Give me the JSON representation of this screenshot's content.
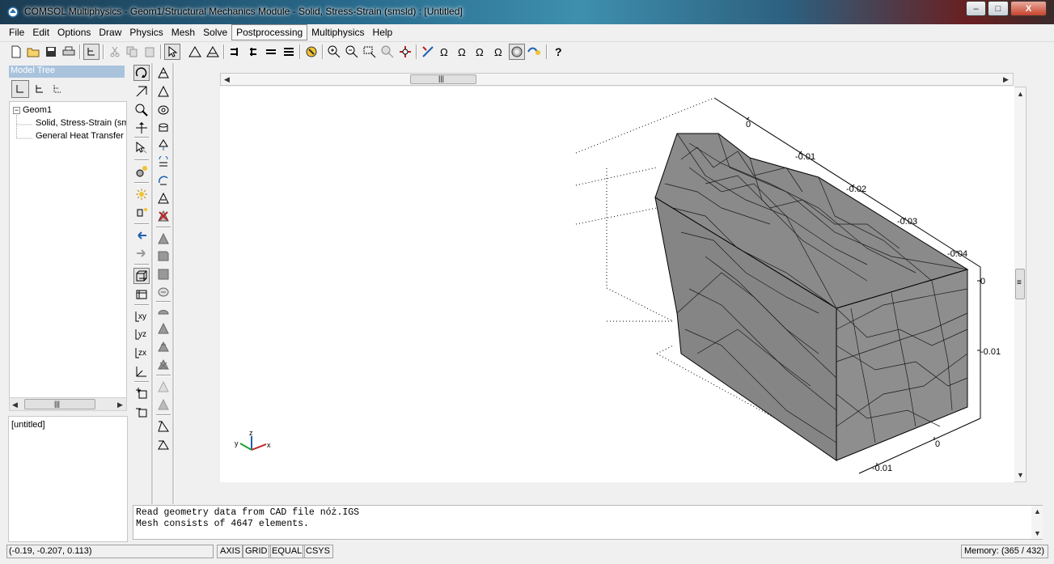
{
  "window": {
    "title": "COMSOL Multiphysics - Geom1/Structural Mechanics Module - Solid, Stress-Strain (smsld) : [Untitled]",
    "minimize_glyph": "–",
    "maximize_glyph": "□",
    "close_glyph": "X"
  },
  "menu": {
    "items": [
      "File",
      "Edit",
      "Options",
      "Draw",
      "Physics",
      "Mesh",
      "Solve",
      "Postprocessing",
      "Multiphysics",
      "Help"
    ],
    "active": "Postprocessing"
  },
  "model_tree": {
    "header": "Model Tree",
    "root": "Geom1",
    "root_expander": "−",
    "children": [
      "Solid, Stress-Strain (sm",
      "General Heat Transfer ("
    ]
  },
  "scroll": {
    "thumb_grip": "|||",
    "left_arrow": "◀",
    "right_arrow": "▶",
    "up_arrow": "▲",
    "down_arrow": "▼",
    "vertical_grip": "≡"
  },
  "file_panel": {
    "text": "[untitled]"
  },
  "console": {
    "lines": [
      "Read geometry data from CAD file nóż.IGS",
      "Mesh consists of 4647 elements."
    ]
  },
  "status": {
    "coordinates": "(-0.19, -0.207, 0.113)",
    "toggles": [
      "AXIS",
      "GRID",
      "EQUAL",
      "CSYS"
    ],
    "memory": "Memory: (365 / 432)"
  },
  "axes": {
    "y_ticks": [
      "0",
      "-0.01",
      "-0.02",
      "-0.03",
      "-0.04"
    ],
    "z_ticks": [
      "0",
      "-0.01"
    ],
    "x_ticks": [
      "0",
      "-0.01"
    ]
  },
  "triad": {
    "x": "x",
    "y": "y",
    "z": "z"
  },
  "colors": {
    "mesh_fill": "#8c8c8c",
    "mesh_edges": "#000000",
    "canvas_bg": "#ffffff",
    "tree_header": "#a9c3dd"
  }
}
